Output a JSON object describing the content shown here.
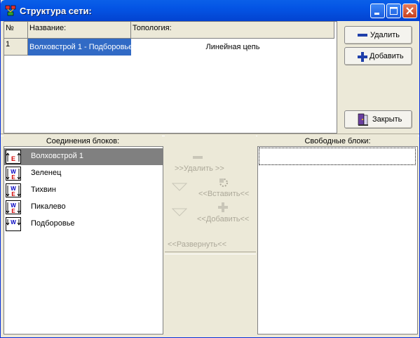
{
  "window": {
    "title": "Структура сети:"
  },
  "grid": {
    "headers": [
      "№",
      "Название:",
      "Топология:"
    ],
    "rows": [
      {
        "num": "1",
        "name": "Волховстрой 1 - Подборовье",
        "topology": "Линейная цепь"
      }
    ]
  },
  "buttons": {
    "delete": "Удалить",
    "add": "Добавить",
    "close": "Закрыть"
  },
  "connections": {
    "header": "Соединения блоков:",
    "items": [
      "Волховстрой 1",
      "Зеленец",
      "Тихвин",
      "Пикалево",
      "Подборовье"
    ],
    "block_letters": {
      "east": "E",
      "west": "W"
    }
  },
  "middle": {
    "remove": ">>Удалить >>",
    "insert": "<<Вставить<<",
    "add": "<<Добавить<<",
    "expand": "<<Развернуть<<"
  },
  "free_blocks": {
    "header": "Свободные блоки:"
  },
  "colors": {
    "title_blue": "#0454E4",
    "selection": "#316AC5",
    "selected_row": "#808080",
    "disabled_text": "#ACA899"
  },
  "icons": [
    "app-network-icon",
    "minimize-icon",
    "maximize-icon",
    "close-icon",
    "minus-icon",
    "plus-icon",
    "exit-door-icon",
    "triangle-down-icon",
    "insert-gear-icon",
    "block-connector-icon"
  ]
}
